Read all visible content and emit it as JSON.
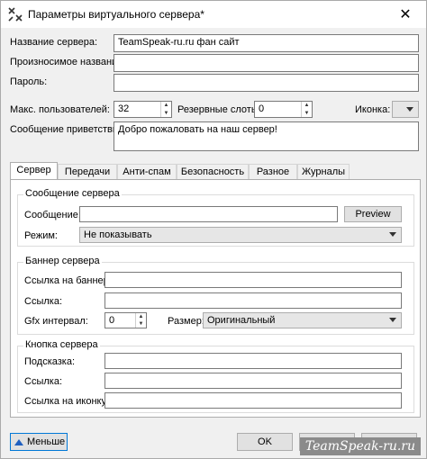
{
  "window": {
    "title": "Параметры виртуального сервера*",
    "close_glyph": "✕",
    "app_icon": "teamspeak-icon"
  },
  "form": {
    "server_name_label": "Название сервера:",
    "server_name_value": "TeamSpeak-ru.ru фан сайт",
    "pronounce_label": "Произносимое название:",
    "pronounce_value": "",
    "password_label": "Пароль:",
    "password_value": "",
    "max_users_label": "Макс. пользователей:",
    "max_users_value": "32",
    "reserved_label": "Резервные слоты:",
    "reserved_value": "0",
    "icon_label": "Иконка:",
    "welcome_label": "Сообщение приветствия:",
    "welcome_value": "Добро пожаловать на наш сервер!"
  },
  "tabs": [
    {
      "label": "Сервер",
      "active": true
    },
    {
      "label": "Передачи"
    },
    {
      "label": "Анти-спам"
    },
    {
      "label": "Безопасность"
    },
    {
      "label": "Разное"
    },
    {
      "label": "Журналы"
    }
  ],
  "server_message": {
    "group_title": "Сообщение сервера",
    "message_label": "Сообщение:",
    "message_value": "",
    "preview_label": "Preview",
    "mode_label": "Режим:",
    "mode_value": "Не показывать"
  },
  "banner": {
    "group_title": "Баннер сервера",
    "banner_link_label": "Ссылка на баннер:",
    "banner_link_value": "",
    "link_label": "Ссылка:",
    "link_value": "",
    "gfx_label": "Gfx интервал:",
    "gfx_value": "0",
    "size_label": "Размер:",
    "size_value": "Оригинальный"
  },
  "server_button": {
    "group_title": "Кнопка сервера",
    "tooltip_label": "Подсказка:",
    "tooltip_value": "",
    "link_label": "Ссылка:",
    "link_value": "",
    "icon_link_label": "Ссылка на иконку:",
    "icon_link_value": ""
  },
  "footer": {
    "less_label": "Меньше",
    "ok_label": "OK",
    "cancel_label": "Отмена",
    "apply_label": "Применить",
    "watermark": "TeamSpeak-ru.ru"
  }
}
